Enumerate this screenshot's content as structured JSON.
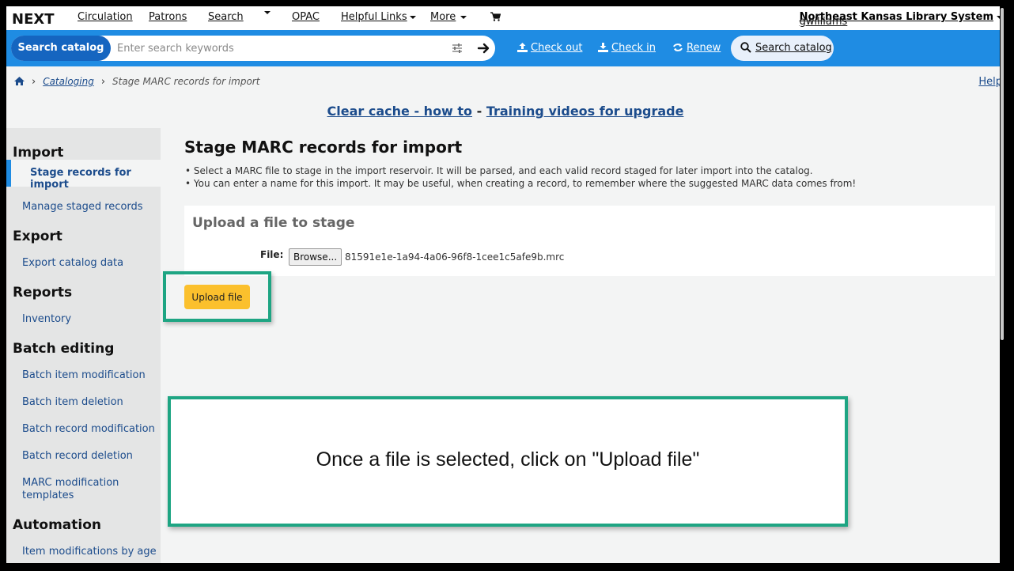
{
  "nav": {
    "logo": "NEXT",
    "items": [
      "Circulation",
      "Patrons",
      "Search",
      "OPAC",
      "Helpful Links",
      "More"
    ],
    "user": "gwilliams",
    "library": "Northeast Kansas Library System"
  },
  "searchbar": {
    "scope_label": "Search catalog",
    "placeholder": "Enter search keywords",
    "checkout": "Check out",
    "checkin": "Check in",
    "renew": "Renew",
    "search_catalog": "Search catalog"
  },
  "breadcrumb": {
    "parent": "Cataloging",
    "current": "Stage MARC records for import",
    "help": "Help"
  },
  "announce": {
    "link1": "Clear cache - how to",
    "sep": " - ",
    "link2": "Training videos for upgrade"
  },
  "sidebar": {
    "import_head": "Import",
    "import_items": [
      "Stage records for import",
      "Manage staged records"
    ],
    "export_head": "Export",
    "export_items": [
      "Export catalog data"
    ],
    "reports_head": "Reports",
    "reports_items": [
      "Inventory"
    ],
    "batch_head": "Batch editing",
    "batch_items": [
      "Batch item modification",
      "Batch item deletion",
      "Batch record modification",
      "Batch record deletion",
      "MARC modification",
      "templates"
    ],
    "automation_head": "Automation",
    "automation_items": [
      "Item modifications by age"
    ]
  },
  "main": {
    "title": "Stage MARC records for import",
    "hints": [
      "Select a MARC file to stage in the import reservoir. It will be parsed, and each valid record staged for later import into the catalog.",
      "You can enter a name for this import. It may be useful, when creating a record, to remember where the suggested MARC data comes from!"
    ],
    "panel_title": "Upload a file to stage",
    "file_label": "File:",
    "browse_label": "Browse...",
    "file_name": "81591e1e-1a94-4a06-96f8-1cee1c5afe9b.mrc",
    "upload_label": "Upload file"
  },
  "callout": {
    "text": "Once a file is selected, click on \"Upload file\""
  },
  "colors": {
    "brand_blue": "#1f8ce3",
    "highlight_green": "#1ea583",
    "upload_yellow": "#fbc02d"
  }
}
